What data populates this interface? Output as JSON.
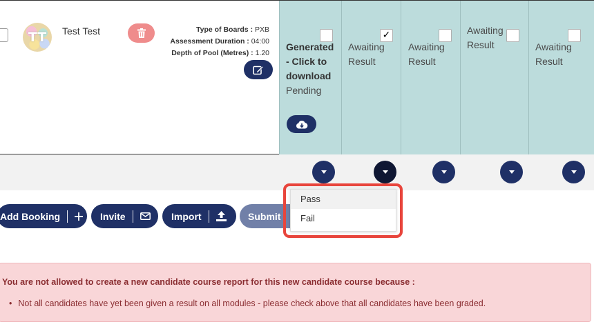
{
  "candidate": {
    "avatar_initials": "TT",
    "name": "Test Test",
    "details": [
      {
        "label": "Type of Boards :",
        "value": "PXB"
      },
      {
        "label": "Assessment Duration :",
        "value": "04:00"
      },
      {
        "label": "Depth of Pool (Metres) :",
        "value": "1.20"
      }
    ]
  },
  "columns": [
    {
      "status_bold": [
        "Generated",
        "- Click to",
        "download"
      ],
      "status": "Pending",
      "checked": false
    },
    {
      "status": [
        "Awaiting",
        "Result"
      ],
      "checked": true
    },
    {
      "status": [
        "Awaiting",
        "Result"
      ],
      "checked": false
    },
    {
      "status": [
        "Awaiting",
        "Result"
      ],
      "checked": false
    },
    {
      "status": [
        "Awaiting",
        "Result"
      ],
      "checked": false
    }
  ],
  "check_mark": "✓",
  "dropdown": {
    "options": [
      "Pass",
      "Fail"
    ]
  },
  "actions": {
    "add_booking": "Add Booking",
    "invite": "Invite",
    "import": "Import",
    "submit": "Submit"
  },
  "alert": {
    "title": "You are not allowed to create a new candidate course report for this new candidate course because :",
    "items": [
      "Not all candidates have yet been given a result on all modules - please check above that all candidates have been graded."
    ]
  },
  "icons": [
    "trash-icon",
    "edit-icon",
    "download-cloud-icon",
    "chevron-down-icon",
    "plus-icon",
    "envelope-icon",
    "upload-icon"
  ],
  "colors": {
    "navy": "#1f3066",
    "teal_col": "#bcdcdc",
    "alert_bg": "#f9d6d8",
    "alert_text": "#8a2d31",
    "highlight": "#e8453c",
    "danger_btn": "#ef8c8c"
  }
}
